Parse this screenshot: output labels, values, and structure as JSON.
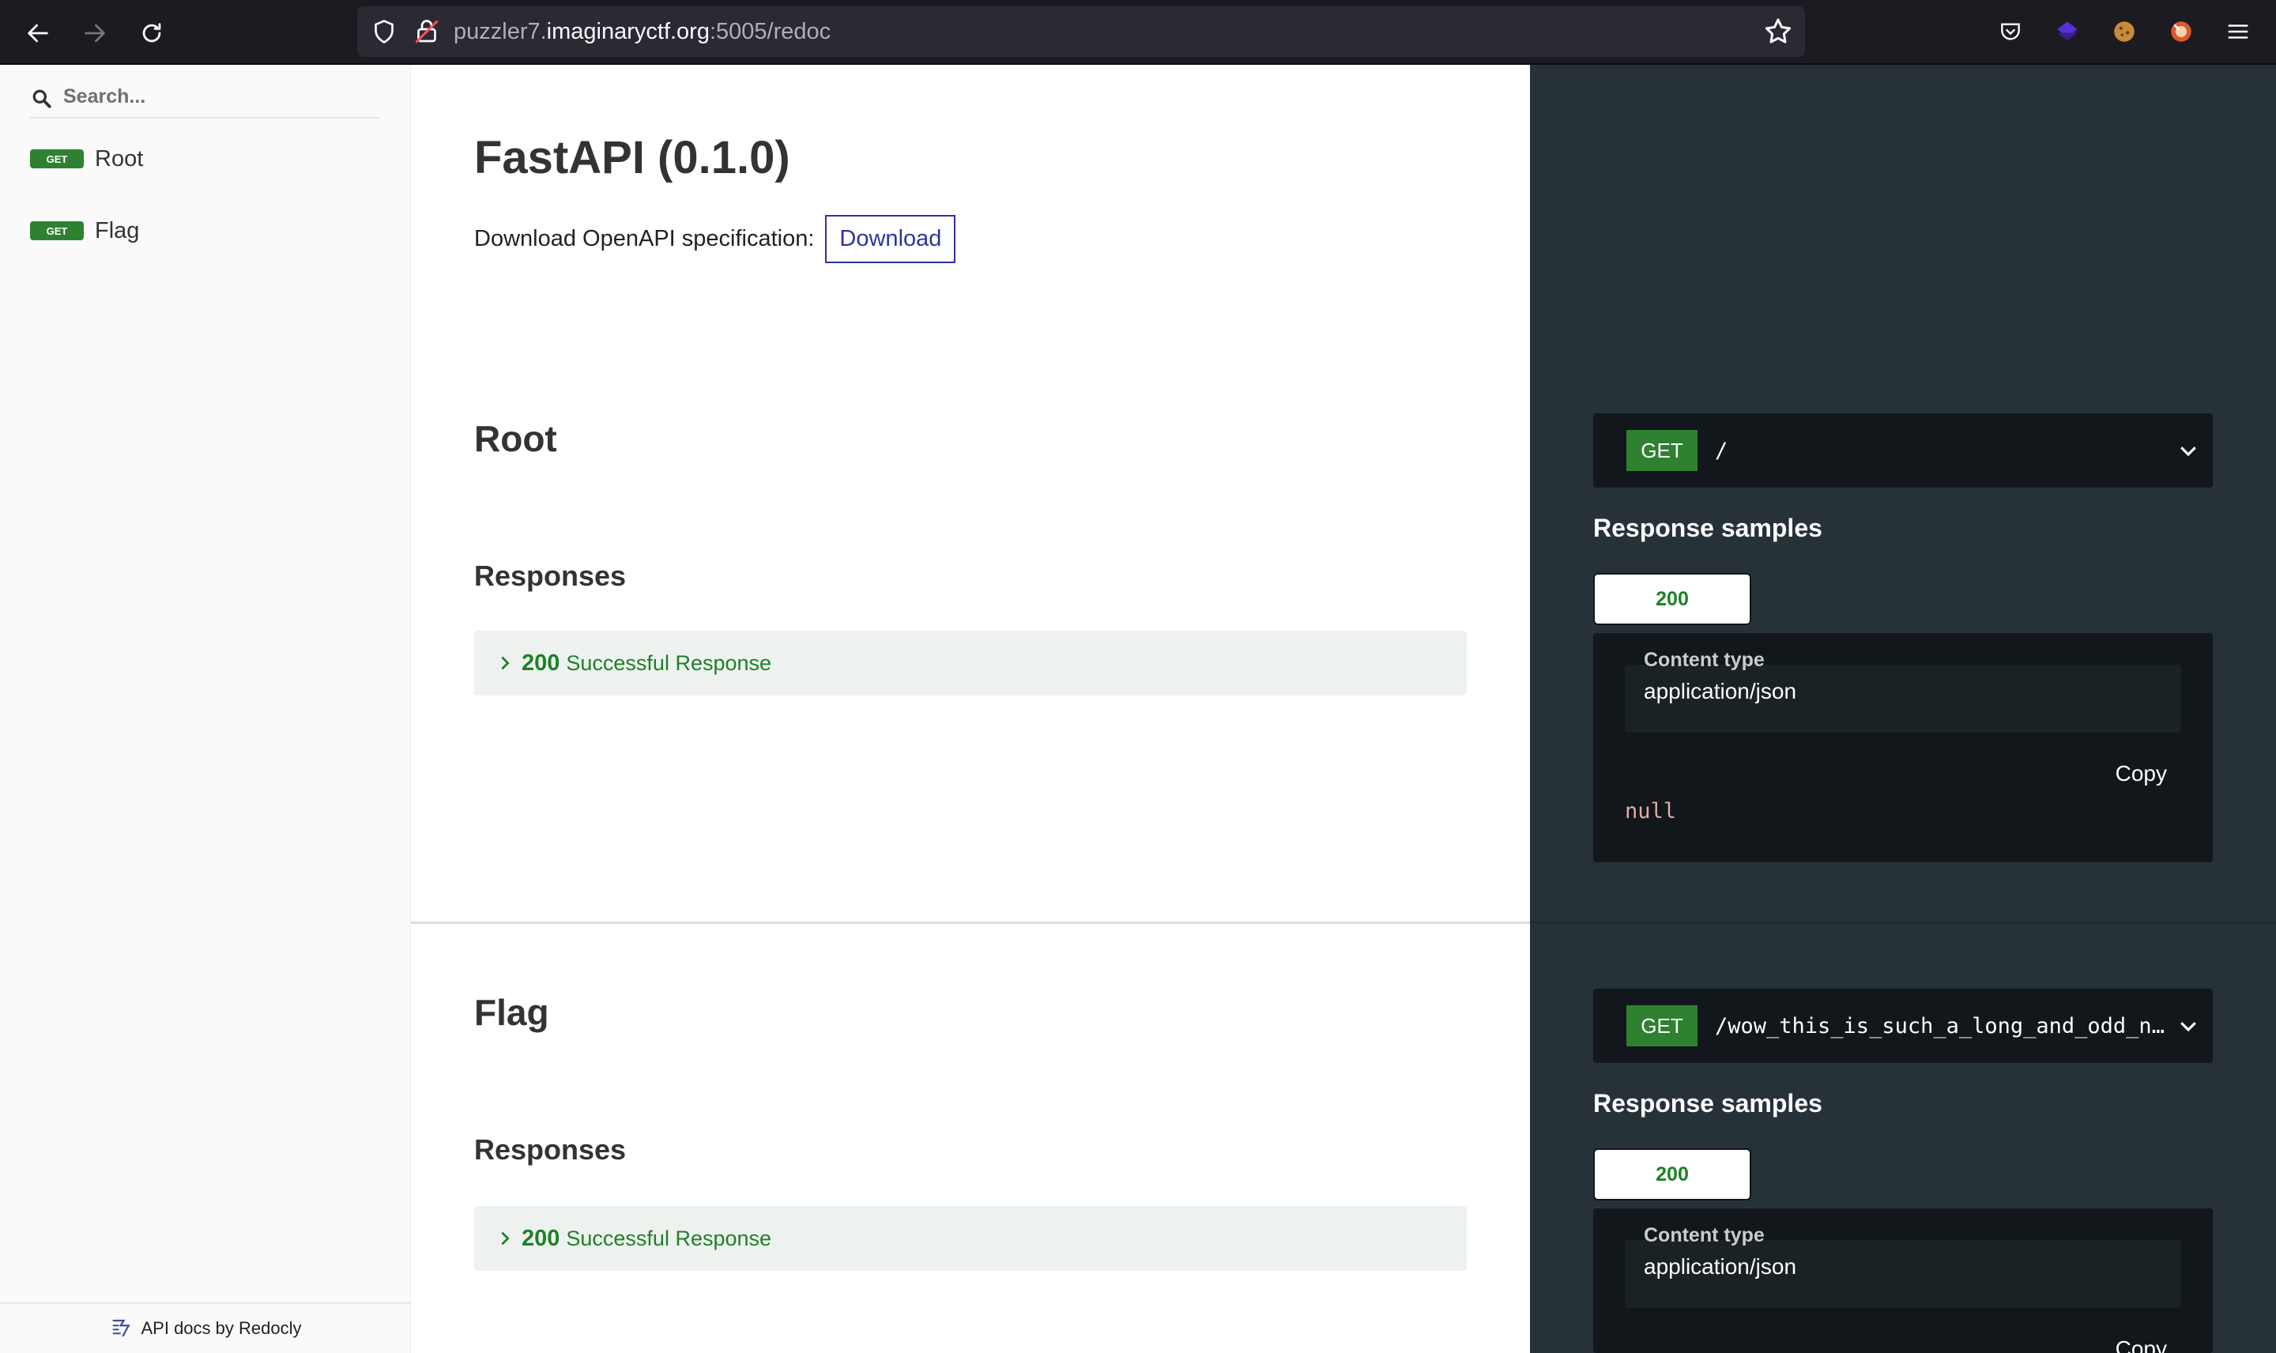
{
  "browser": {
    "url_prefix": "puzzler7.",
    "url_host": "imaginaryctf.org",
    "url_suffix": ":5005/redoc"
  },
  "sidebar": {
    "search_placeholder": "Search...",
    "items": [
      {
        "method": "GET",
        "label": "Root"
      },
      {
        "method": "GET",
        "label": "Flag"
      }
    ],
    "footer": "API docs by Redocly"
  },
  "main": {
    "title": "FastAPI (0.1.0)",
    "download_label": "Download OpenAPI specification:",
    "download_button": "Download",
    "operations": [
      {
        "title": "Root",
        "responses_heading": "Responses",
        "response_code": "200",
        "response_desc": "Successful Response",
        "method": "GET",
        "path": "/",
        "samples_heading": "Response samples",
        "tab": "200",
        "content_type_label": "Content type",
        "content_type": "application/json",
        "copy": "Copy",
        "sample_value": "null"
      },
      {
        "title": "Flag",
        "responses_heading": "Responses",
        "response_code": "200",
        "response_desc": "Successful Response",
        "method": "GET",
        "path": "/wow_this_is_such_a_long_and_odd_na…",
        "samples_heading": "Response samples",
        "tab": "200",
        "content_type_label": "Content type",
        "content_type": "application/json",
        "copy": "Copy"
      }
    ]
  },
  "colors": {
    "get_badge": "#2f8132",
    "right_panel": "#263238",
    "success_text": "#1d8127",
    "download_border": "#32329f"
  }
}
